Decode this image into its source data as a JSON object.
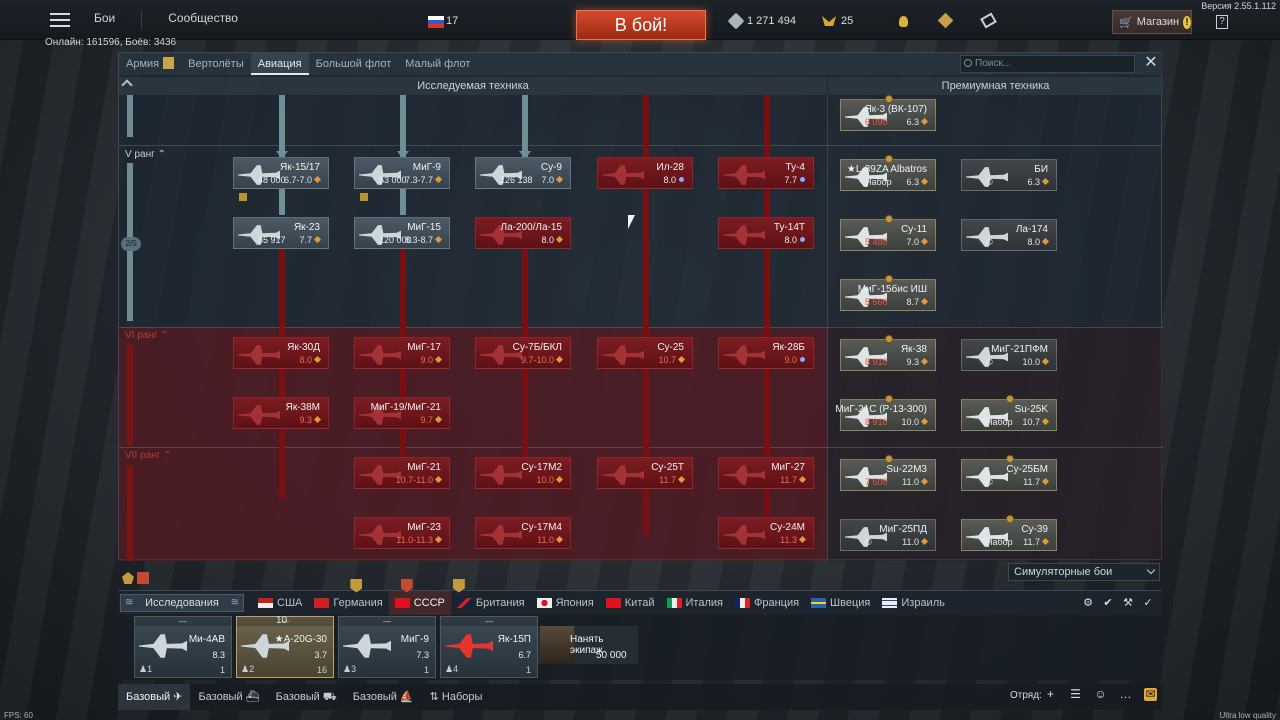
{
  "version": "Версия 2.55.1.112",
  "topnav": {
    "battles": "Бои",
    "community": "Сообщество"
  },
  "online": "Онлайн: 161596, Боёв: 3436",
  "player": {
    "value": "17"
  },
  "battle_button": "В бой!",
  "currency": {
    "lions": "1 271 494",
    "eagles": "25"
  },
  "shop": "Магазин",
  "help": "?",
  "tabs": [
    "Армия",
    "Вертолёты",
    "Авиация",
    "Большой флот",
    "Малый флот"
  ],
  "active_tab": "Авиация",
  "search_placeholder": "Поиск...",
  "headers": {
    "research": "Исследуемая техника",
    "premium": "Премиумная техника"
  },
  "ranks": {
    "r5": "V ранг",
    "r6": "VI ранг",
    "r7": "VII ранг",
    "progress": "2/5"
  },
  "tree": [
    {
      "name": "Як-15/17",
      "stat": "6.7-7.0",
      "sl": "48 000",
      "state": "researched"
    },
    {
      "name": "МиГ-9",
      "stat": "7.3-7.7",
      "sl": "53 000",
      "state": "researched"
    },
    {
      "name": "Су-9",
      "stat": "7.0",
      "sl": "126 138",
      "state": "researched"
    },
    {
      "name": "Ил-28",
      "stat": "8.0",
      "state": "locked"
    },
    {
      "name": "Ту-4",
      "stat": "7.7",
      "state": "locked"
    },
    {
      "name": "Як-23",
      "stat": "7.7",
      "sl": "65 917",
      "state": "researched"
    },
    {
      "name": "МиГ-15",
      "stat": "8.3-8.7",
      "sl": "120 000",
      "state": "researched"
    },
    {
      "name": "Ла-200/Ла-15",
      "stat": "8.0",
      "state": "locked"
    },
    {
      "name": "Ту-14Т",
      "stat": "8.0",
      "state": "locked"
    },
    {
      "name": "Як-30Д",
      "stat": "8.0",
      "state": "locked"
    },
    {
      "name": "МиГ-17",
      "stat": "9.0",
      "state": "locked"
    },
    {
      "name": "Су-7Б/БКЛ",
      "stat": "9.7-10.0",
      "state": "locked"
    },
    {
      "name": "Су-25",
      "stat": "10.7",
      "state": "locked"
    },
    {
      "name": "Як-28Б",
      "stat": "9.0",
      "state": "locked"
    },
    {
      "name": "Як-38М",
      "stat": "9.3",
      "state": "locked"
    },
    {
      "name": "МиГ-19/МиГ-21",
      "stat": "9.7",
      "state": "locked"
    },
    {
      "name": "МиГ-21",
      "stat": "10.7-11.0",
      "state": "locked"
    },
    {
      "name": "Су-17М2",
      "stat": "10.0",
      "state": "locked"
    },
    {
      "name": "Су-25Т",
      "stat": "11.7",
      "state": "locked"
    },
    {
      "name": "МиГ-27",
      "stat": "11.7",
      "state": "locked"
    },
    {
      "name": "МиГ-23",
      "stat": "11.0-11.3",
      "state": "locked"
    },
    {
      "name": "Су-17М4",
      "stat": "11.0",
      "state": "locked"
    },
    {
      "name": "Су-24М",
      "stat": "11.3",
      "state": "locked"
    }
  ],
  "premium": [
    {
      "name": "Як-3 (ВК-107)",
      "stat": "6.3",
      "sl": "6 090"
    },
    {
      "name": "★L-39ZA Albatros",
      "stat": "6.3",
      "sl": "Набор"
    },
    {
      "name": "БИ",
      "stat": "6.3",
      "sl": "©"
    },
    {
      "name": "Су-11",
      "stat": "7.0",
      "sl": "5 480"
    },
    {
      "name": "Ла-174",
      "stat": "8.0",
      "sl": "©"
    },
    {
      "name": "МиГ-15бис ИШ",
      "stat": "8.7",
      "sl": "5 560"
    },
    {
      "name": "Як-38",
      "stat": "9.3",
      "sl": "8 910"
    },
    {
      "name": "МиГ-21ПФМ",
      "stat": "10.0",
      "sl": "©"
    },
    {
      "name": "МиГ-21С (Р-13-300)",
      "stat": "10.0",
      "sl": "8 910"
    },
    {
      "name": "Su-25K",
      "stat": "10.7",
      "sl": "Набор"
    },
    {
      "name": "Su-22M3",
      "stat": "11.0",
      "sl": "7 500"
    },
    {
      "name": "Су-25БМ",
      "stat": "11.7",
      "sl": "©"
    },
    {
      "name": "МиГ-25ПД",
      "stat": "11.0",
      "sl": "©"
    },
    {
      "name": "Су-39",
      "stat": "11.7",
      "sl": "Набор"
    }
  ],
  "mode": "Симуляторные бои",
  "research_button": "Исследования",
  "countries": [
    "США",
    "Германия",
    "СССР",
    "Британия",
    "Япония",
    "Китай",
    "Италия",
    "Франция",
    "Швеция",
    "Израиль"
  ],
  "active_country": "СССР",
  "crew": [
    {
      "name": "Ми-4АВ",
      "br": "8.3",
      "crew": "1",
      "count": "1",
      "top": "—"
    },
    {
      "name": "★A-20G-30",
      "br": "3.7",
      "crew": "2",
      "count": "16",
      "top": "—"
    },
    {
      "name": "МиГ-9",
      "br": "7.3",
      "crew": "3",
      "count": "1",
      "top": "—"
    },
    {
      "name": "Як-15П",
      "br": "6.7",
      "crew": "4",
      "count": "1",
      "top": "—"
    }
  ],
  "slot_top_number": "10",
  "hire": {
    "title": "Нанять экипаж",
    "cost": "50 000"
  },
  "presets": [
    "Базовый",
    "Базовый",
    "Базовый",
    "Базовый",
    "Наборы"
  ],
  "squad": "Отряд:",
  "fps": "FPS: 60",
  "quality": "Ultra low quality"
}
